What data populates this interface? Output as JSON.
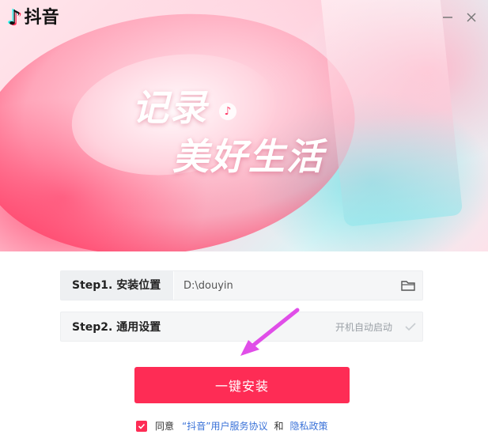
{
  "app": {
    "name": "抖音",
    "logo_icon": "tiktok-note-icon"
  },
  "window": {
    "minimize_icon": "minimize-icon",
    "close_icon": "close-icon"
  },
  "banner": {
    "slogan_line1": "记录",
    "slogan_line2": "美好生活"
  },
  "steps": [
    {
      "label": "Step1. 安装位置",
      "value": "D:\\douyin",
      "icon": "folder-icon"
    },
    {
      "label": "Step2. 通用设置",
      "option_label": "开机自动启动",
      "option_checked": false,
      "icon": "checkmark-icon"
    }
  ],
  "install_button": {
    "label": "一键安装"
  },
  "agreement": {
    "checked": true,
    "prefix": "同意",
    "terms_link": "“抖音”用户服务协议",
    "and": "和",
    "privacy_link": "隐私政策"
  },
  "colors": {
    "accent": "#fe2c55",
    "link": "#3a72d8"
  }
}
